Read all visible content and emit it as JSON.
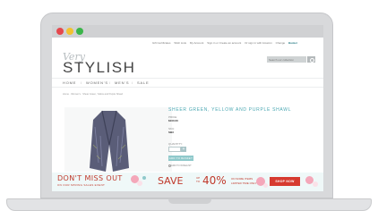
{
  "window": {
    "controls": [
      "close",
      "minimize",
      "maximize"
    ]
  },
  "top_links": {
    "items": [
      "Gift Certificates",
      "Wish Lists",
      "My Account",
      "Sign in or Create an account",
      "Or sign in with Amazon",
      "Change"
    ],
    "basket_label": "Basket"
  },
  "logo": {
    "script": "Very",
    "main": "STYLISH"
  },
  "search": {
    "placeholder": "Search our collection"
  },
  "nav": {
    "items": [
      "HOME",
      "WOMEN'S",
      "MEN'S",
      "SALE"
    ],
    "separator": "/"
  },
  "breadcrumb": "Home  ·  Women's  ·  Shear Green, Yellow and Purple Shawl",
  "product": {
    "title": "SHEER GREEN, YELLOW AND PURPLE SHAWL",
    "price_label": "PRICE:",
    "price": "$100.00",
    "sku_label": "SKU:",
    "sku": "SB3",
    "quantity_label": "QUANTITY:",
    "quantity_value": "",
    "quantity_plus": "+",
    "add_button": "ADD TO BASKET",
    "wishlist": "ADD TO WISHLIST"
  },
  "banner": {
    "headline": "DON'T MISS OUT",
    "subline": "ON OUR SPRING SALES EVENT",
    "save": "SAVE",
    "up_to": "UP TO",
    "percent": "40%",
    "detail1": "ON SOME ITEMS",
    "detail2": "LIMITED TIME ONLY",
    "cta": "SHOP NOW"
  },
  "colors": {
    "accent": "#4aa7b2",
    "banner_red": "#c0392b",
    "cta_red": "#d63a2f",
    "button_teal": "#8fc9cb"
  }
}
